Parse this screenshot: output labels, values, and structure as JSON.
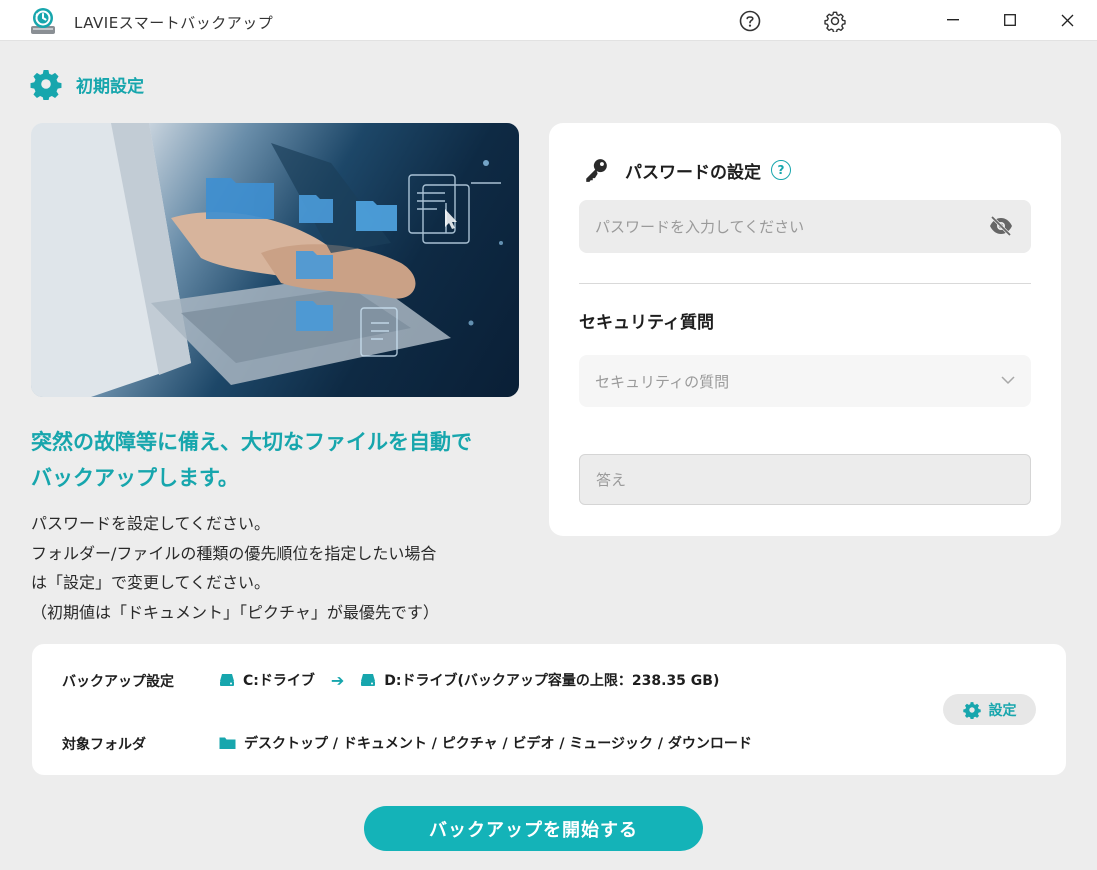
{
  "window": {
    "title": "LAVIEスマートバックアップ",
    "icons": [
      "app-logo-icon",
      "help-icon",
      "gear-icon",
      "minimize-icon",
      "maximize-icon",
      "close-icon"
    ]
  },
  "section": {
    "title": "初期設定",
    "icon": "gear-icon"
  },
  "hero": {
    "image": "hands-typing-laptop-with-floating-folders",
    "headline_line1": "突然の故障等に備え、大切なファイルを自動で",
    "headline_line2": "バックアップします。",
    "desc_line1": "パスワードを設定してください。",
    "desc_line2": "フォルダー/ファイルの種類の優先順位を指定したい場合",
    "desc_line3": "は「設定」で変更してください。",
    "desc_line4": "（初期値は「ドキュメント」「ピクチャ」が最優先です）"
  },
  "password": {
    "heading": "パスワードの設定",
    "help_glyph": "?",
    "placeholder": "パスワードを入力してください",
    "value": "",
    "icon": "key-icon",
    "toggle_icon": "eye-off-icon"
  },
  "security": {
    "heading": "セキュリティ質問",
    "select_placeholder": "セキュリティの質問",
    "answer_placeholder": "答え",
    "answer_value": ""
  },
  "backup_info": {
    "backup_label": "バックアップ設定",
    "source_drive": "C:ドライブ",
    "dest_drive": "D:ドライブ(バックアップ容量の上限：238.35 GB)",
    "target_label": "対象フォルダ",
    "target_folders": "デスクトップ / ドキュメント / ピクチャ / ビデオ / ミュージック / ダウンロード",
    "settings_button": "設定"
  },
  "actions": {
    "start_button": "バックアップを開始する"
  },
  "colors": {
    "accent": "#17a6ad",
    "button": "#14b3b8",
    "background": "#ededed"
  }
}
